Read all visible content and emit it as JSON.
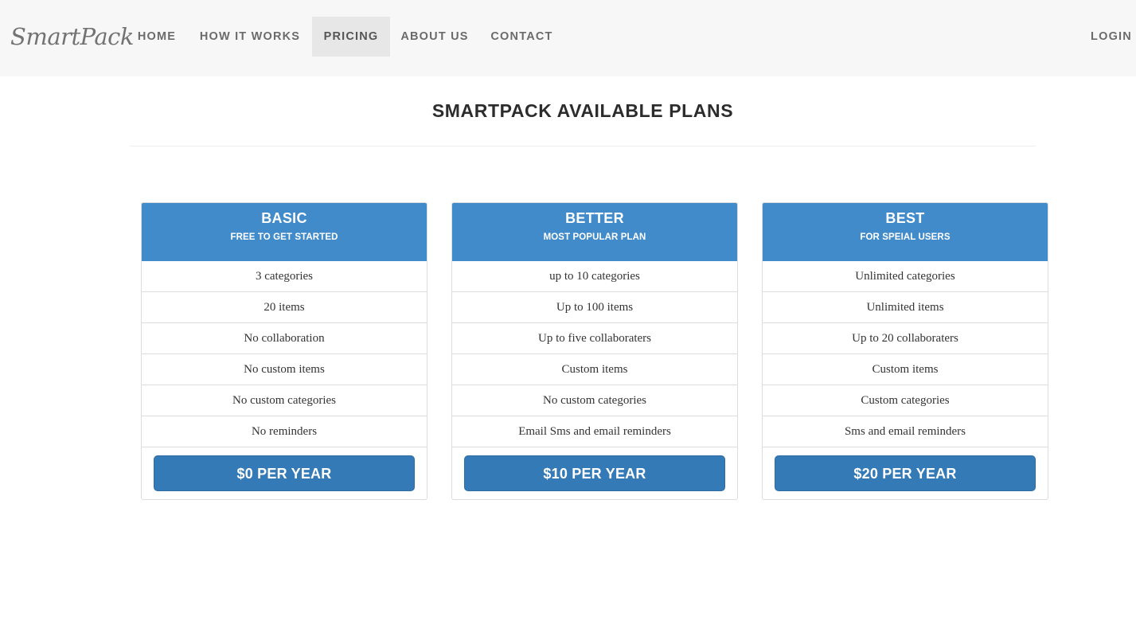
{
  "brand": "SmartPack",
  "nav": {
    "home": "HOME",
    "how_it_works": "HOW IT WORKS",
    "pricing": "PRICING",
    "about_us": "ABOUT US",
    "contact": "CONTACT",
    "login": "LOGIN",
    "active_item": "PRICING"
  },
  "page_title": "SMARTPACK AVAILABLE PLANS",
  "colors": {
    "plan_header": "#428bca",
    "price_button": "#337ab7",
    "navbar_bg": "#f7f7f7"
  },
  "plans": [
    {
      "name": "BASIC",
      "tagline": "FREE TO GET STARTED",
      "features": [
        "3 categories",
        "20 items",
        "No collaboration",
        "No custom items",
        "No custom categories",
        "No reminders"
      ],
      "price_label": "$0 PER YEAR"
    },
    {
      "name": "BETTER",
      "tagline": "MOST POPULAR PLAN",
      "features": [
        "up to 10 categories",
        "Up to 100 items",
        "Up to five collaboraters",
        "Custom items",
        "No custom categories",
        "Email Sms and email reminders"
      ],
      "price_label": "$10 PER YEAR"
    },
    {
      "name": "BEST",
      "tagline": "FOR SPEIAL USERS",
      "features": [
        "Unlimited categories",
        "Unlimited items",
        "Up to 20 collaboraters",
        "Custom items",
        "Custom categories",
        "Sms and email reminders"
      ],
      "price_label": "$20 PER YEAR"
    }
  ]
}
